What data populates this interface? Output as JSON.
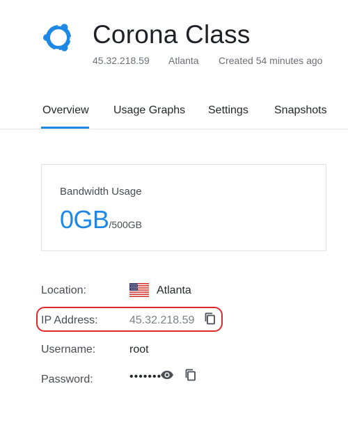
{
  "server": {
    "title": "Corona Class",
    "os_icon": "ubuntu-logo-icon",
    "ip": "45.32.218.59",
    "location": "Atlanta",
    "created": "Created 54 minutes ago"
  },
  "tabs": [
    {
      "label": "Overview",
      "active": true
    },
    {
      "label": "Usage Graphs",
      "active": false
    },
    {
      "label": "Settings",
      "active": false
    },
    {
      "label": "Snapshots",
      "active": false
    }
  ],
  "bandwidth": {
    "label": "Bandwidth Usage",
    "used": "0GB",
    "total": "/500GB"
  },
  "details": {
    "location_label": "Location:",
    "location_value": "Atlanta",
    "location_flag": "us-flag-icon",
    "ip_label": "IP Address:",
    "ip_value": "45.32.218.59",
    "username_label": "Username:",
    "username_value": "root",
    "password_label": "Password:",
    "password_value": "•••••••"
  },
  "colors": {
    "accent": "#1e88e5",
    "highlight": "#e0262b"
  }
}
